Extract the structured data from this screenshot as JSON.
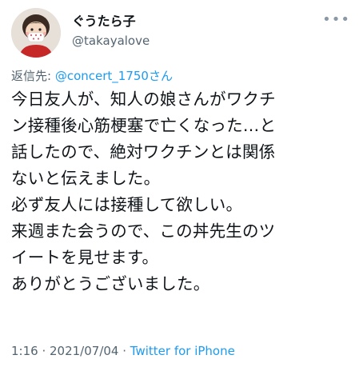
{
  "user": {
    "display_name": "ぐうたら子",
    "handle": "@takayalove",
    "avatar": "avatar-illustration"
  },
  "more_icon": "more-options-icon",
  "reply": {
    "prefix": "返信先: ",
    "mention": "@concert_1750さん"
  },
  "tweet": {
    "text": "今日友人が、知人の娘さんがワクチ\nン接種後心筋梗塞で亡くなった…と\n話したので、絶対ワクチンとは関係\nないと伝えました。\n必ず友人には接種して欲しい。\n来週また会うので、この丼先生のツ\nイートを見せます。\nありがとうございました。"
  },
  "meta": {
    "time": "1:16",
    "separator1": " · ",
    "date": "2021/07/04",
    "separator2": " · ",
    "source": "Twitter for iPhone"
  },
  "colors": {
    "accent": "#1d9bf0",
    "secondary_text": "#536471",
    "primary_text": "#0f1419"
  }
}
